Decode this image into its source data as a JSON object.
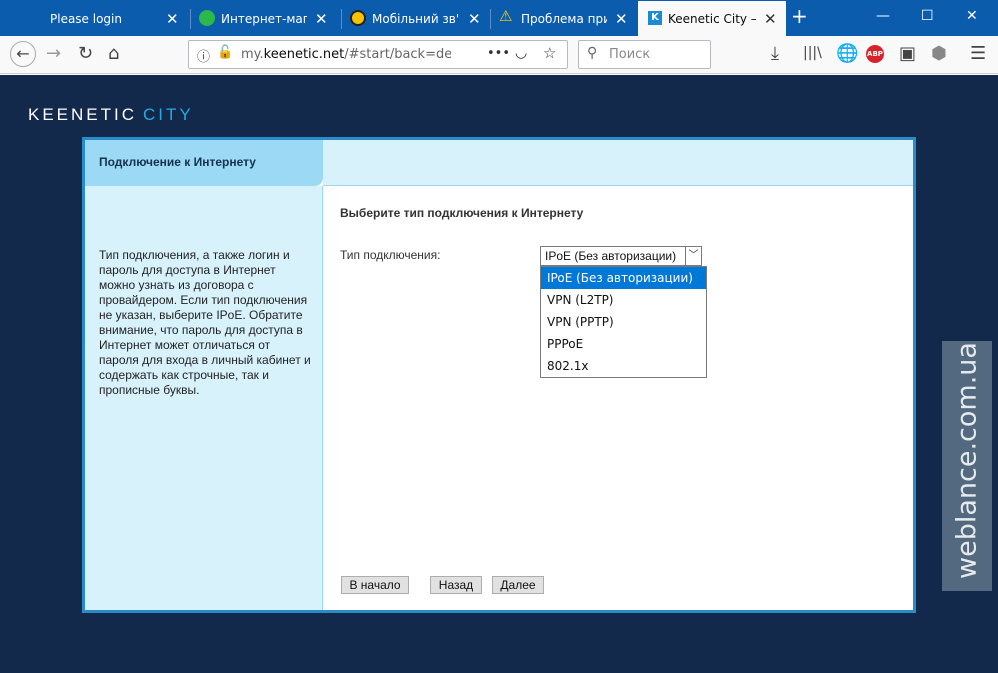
{
  "browser": {
    "tabs": [
      {
        "title": "Please login",
        "icon": "none"
      },
      {
        "title": "Интернет-магазин",
        "icon": "green-smiley-icon"
      },
      {
        "title": "Мобільний зв'язок",
        "icon": "yellow-swirl-icon"
      },
      {
        "title": "Проблема при з",
        "icon": "warning-icon"
      },
      {
        "title": "Keenetic City – M",
        "icon": "keenetic-k-icon"
      }
    ],
    "url_prefix": "my.",
    "url_domain": "keenetic.net",
    "url_rest": "/#start/back=detec",
    "search_placeholder": "Поиск",
    "url_more": "•••",
    "new_tab": "+",
    "minimize": "—",
    "maximize": "☐",
    "close": "✕"
  },
  "app": {
    "logo_main": "KEENETIC",
    "logo_sub": "CITY",
    "left_header": "Подключение к Интернету",
    "help_text": "Тип подключения, а также логин и пароль для доступа в Интернет можно узнать из договора с провайдером. Если тип подключения не указан, выберите IPoE. Обратите внимание, что пароль для доступа в Интернет может отличаться от пароля для входа в личный кабинет и содержать как строчные, так и прописные буквы.",
    "content_title": "Выберите тип подключения к Интернету",
    "connection_label": "Тип подключения:",
    "selected_value": "IPoE (Без авторизации)",
    "options": [
      "IPoE (Без авторизации)",
      "VPN (L2TP)",
      "VPN (PPTP)",
      "PPPoE",
      "802.1x"
    ],
    "btn_start": "В начало",
    "btn_back": "Назад",
    "btn_next": "Далее"
  },
  "watermark": "weblance.com.ua",
  "colors": {
    "tabbar": "#0b5cad",
    "page_bg": "#13294b",
    "frame_border": "#2a8bc9",
    "accent": "#0078d7"
  }
}
